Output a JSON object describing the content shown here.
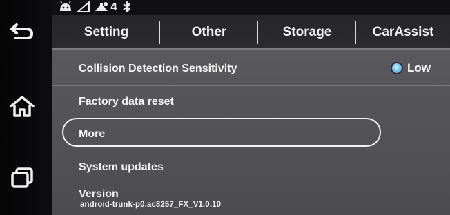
{
  "status_bar": {
    "icons": [
      "android-icon",
      "signal-triangle-icon",
      "usb-icon",
      "bluetooth-icon"
    ],
    "count": "4"
  },
  "nav": {
    "items": [
      {
        "name": "back",
        "icon": "back-arrow-icon"
      },
      {
        "name": "home",
        "icon": "home-icon"
      },
      {
        "name": "recents",
        "icon": "recent-apps-icon"
      }
    ]
  },
  "tabs": [
    {
      "label": "Setting",
      "active": false
    },
    {
      "label": "Other",
      "active": true
    },
    {
      "label": "Storage",
      "active": false
    },
    {
      "label": "CarAssist",
      "active": false
    }
  ],
  "rows": {
    "collision": {
      "label": "Collision Detection Sensitivity",
      "value": "Low"
    },
    "factory_reset": {
      "label": "Factory data reset"
    },
    "more": {
      "label": "More"
    },
    "system_updates": {
      "label": "System updates"
    },
    "version": {
      "label": "Version",
      "value": "android-trunk-p0.ac8257_FX_V1.0.10"
    }
  },
  "colors": {
    "accent": "#3fb5f0",
    "panel": "#56565a",
    "tab_bar": "#2a2a2e"
  }
}
